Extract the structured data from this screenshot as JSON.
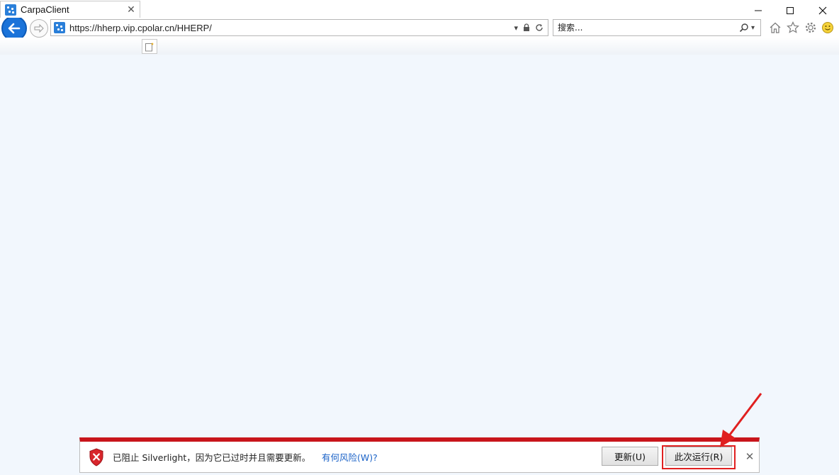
{
  "window": {
    "minimize_glyph": "—",
    "maximize_glyph": "☐",
    "close_glyph": "✕"
  },
  "navigation": {
    "back_icon": "back-arrow-icon",
    "forward_icon": "forward-arrow-icon"
  },
  "address_bar": {
    "url": "https://hherp.vip.cpolar.cn/HHERP/",
    "tools": [
      "dropdown-icon",
      "lock-icon",
      "refresh-icon"
    ]
  },
  "search": {
    "placeholder": "搜索..."
  },
  "toolbar": {
    "icons": [
      "home-icon",
      "favorites-star-icon",
      "tools-gear-icon",
      "feedback-smiley-icon"
    ]
  },
  "tabs": [
    {
      "title": "CarpaClient",
      "active": true
    }
  ],
  "notification": {
    "message": "已阻止 Silverlight，因为它已过时并且需要更新。",
    "link": "有何风险(W)?",
    "update_button": "更新(U)",
    "run_button": "此次运行(R)",
    "accent_color": "#c8151b",
    "highlight_color": "#e02020"
  },
  "colors": {
    "content_background": "#f2f7fd",
    "back_button": "#1a73d9",
    "link": "#1a62c7"
  }
}
